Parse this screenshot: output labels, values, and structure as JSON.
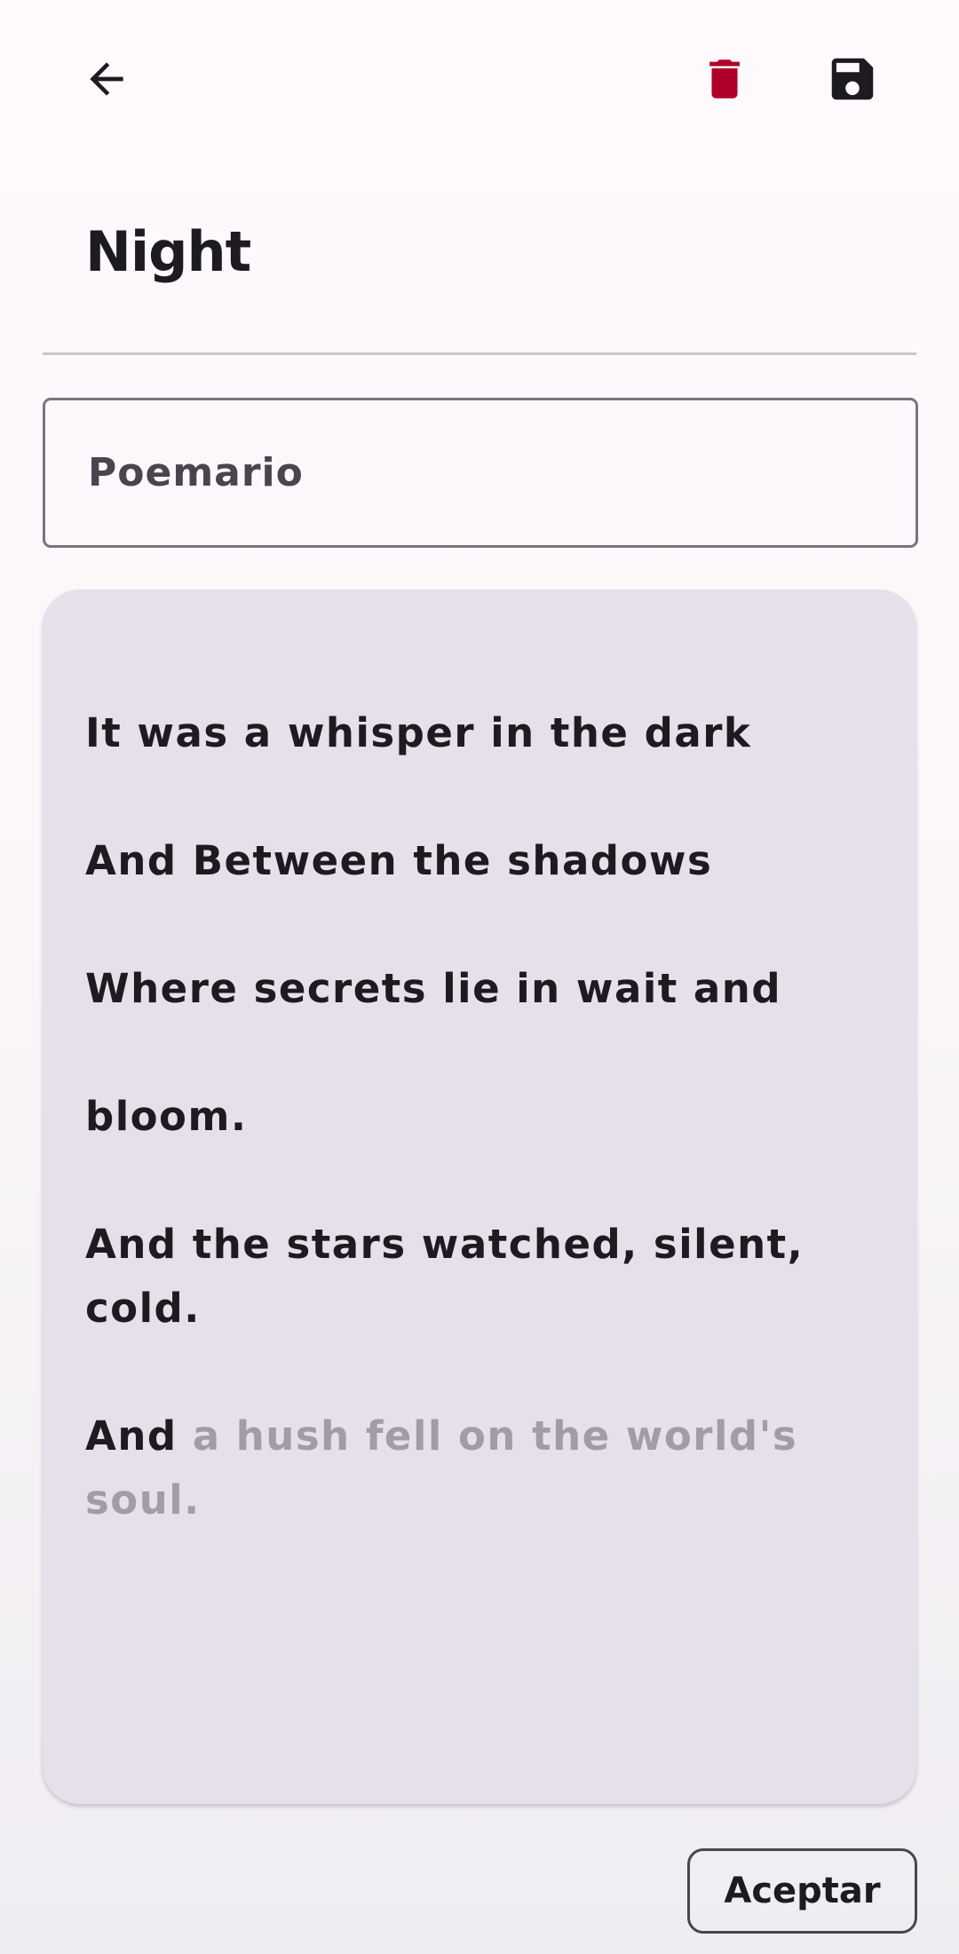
{
  "header": {
    "back_icon": "arrow-left-icon",
    "delete_icon": "trash-icon",
    "save_icon": "floppy-disk-icon",
    "delete_color": "#b0002a"
  },
  "poem": {
    "title": "Night",
    "collection": "Poemario",
    "lines": [
      "It was a whisper in the dark",
      "And Between the shadows",
      "Where secrets lie in wait and",
      "bloom.",
      "And the stars watched, silent, cold."
    ],
    "last_line_typed": "And ",
    "last_line_suggestion": "a hush fell on the world's soul."
  },
  "actions": {
    "accept_label": "Aceptar"
  }
}
